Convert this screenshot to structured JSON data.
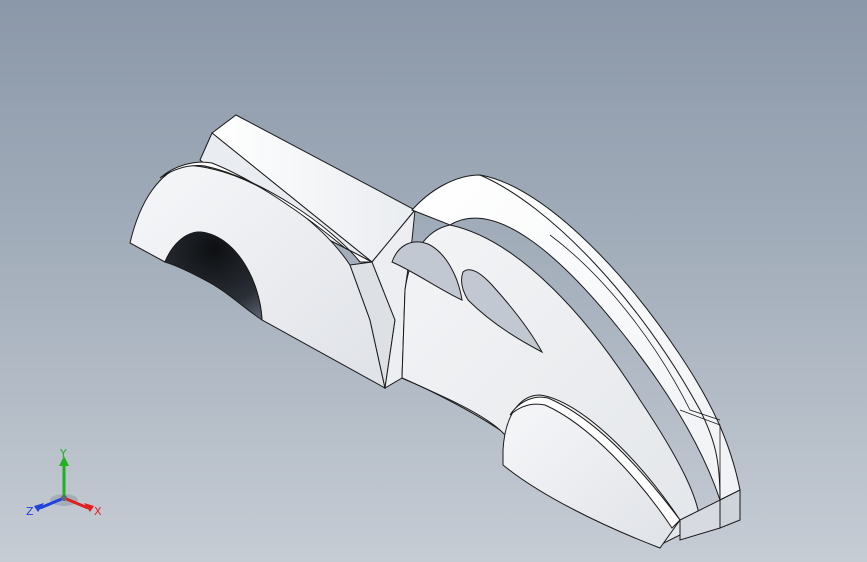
{
  "viewport": {
    "background_top": "#8b98a9",
    "background_bottom": "#c6ccd4"
  },
  "model": {
    "name": "car-body",
    "face_light": "#ffffff",
    "face_mid": "#eef0f3",
    "face_shade": "#d7dbe1",
    "edge_color": "#1a1a1a",
    "window_fill": "#c2c8d2"
  },
  "triad": {
    "x_label": "X",
    "y_label": "Y",
    "z_label": "Z",
    "x_color": "#e02020",
    "y_color": "#20b020",
    "z_color": "#2040e0"
  }
}
